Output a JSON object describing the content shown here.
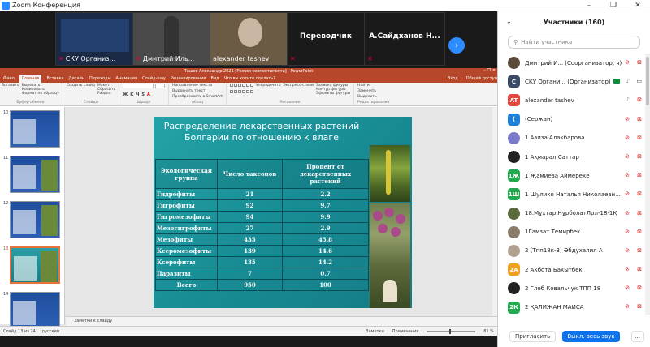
{
  "window": {
    "title": "Zoom Конференция",
    "minimize": "–",
    "restore": "❐",
    "close": "✕",
    "accent": "#2D8CFF"
  },
  "strip": {
    "tiles": [
      {
        "name": "СКУ Организ...",
        "bg": "#1b2a44"
      },
      {
        "name": "Дмитрий Иль...",
        "bg": "#4a4a4a"
      },
      {
        "name": "alexander tashev",
        "bg": "#6b5a44"
      },
      {
        "name": "Переводчик",
        "bg": "#1a1a1a"
      },
      {
        "name": "А.Сайдханов  Н...",
        "bg": "#1a1a1a"
      }
    ],
    "next_icon": "›"
  },
  "ppt": {
    "window_title": "Ташев Александр 2021 [Режим совместимости] - PowerPoint",
    "tabs": [
      "Файл",
      "Главная",
      "Вставка",
      "Дизайн",
      "Переходы",
      "Анимация",
      "Слайд-шоу",
      "Рецензирование",
      "Вид",
      "Что вы хотите сделать?"
    ],
    "active_tab": "Главная",
    "signin": "Вход",
    "share_label": "Общий доступ",
    "ribbon": {
      "paste": "Вставить",
      "cut": "Вырезать",
      "copy": "Копировать",
      "format_painter": "Формат по образцу",
      "clipboard": "Буфер обмена",
      "new_slide": "Создать слайд",
      "layout": "Макет",
      "reset": "Сбросить",
      "section": "Раздел",
      "slides": "Слайды",
      "font": "Шрифт",
      "text_direction": "Направление текста",
      "align_text": "Выровнять текст",
      "smartart": "Преобразовать в SmartArt",
      "paragraph": "Абзац",
      "drawing": "Рисование",
      "arrange": "Упорядочить",
      "quick_styles": "Экспресс-стили",
      "fill": "Заливка фигуры",
      "outline": "Контур фигуры",
      "effects": "Эффекты фигуры",
      "find": "Найти",
      "replace": "Заменить",
      "select": "Выделить",
      "editing": "Редактирование"
    },
    "thumbs": [
      {
        "no": "10",
        "sel": false
      },
      {
        "no": "11",
        "sel": false
      },
      {
        "no": "12",
        "sel": false
      },
      {
        "no": "13",
        "sel": true
      },
      {
        "no": "14",
        "sel": false
      }
    ],
    "slide": {
      "title": "Распределение лекарственных растений Болгарии по отношению к влаге",
      "headers": [
        "Экологическая группа",
        "Число таксонов",
        "Процент от лекарственных растений"
      ],
      "rows": [
        [
          "Гидрофиты",
          "21",
          "2.2"
        ],
        [
          "Гигрофиты",
          "92",
          "9.7"
        ],
        [
          "Гигромезофиты",
          "94",
          "9.9"
        ],
        [
          "Мезогигрофиты",
          "27",
          "2.9"
        ],
        [
          "Мезофиты",
          "435",
          "45.8"
        ],
        [
          "Ксеромезофиты",
          "139",
          "14.6"
        ],
        [
          "Ксерофиты",
          "135",
          "14.2"
        ],
        [
          "Паразиты",
          "7",
          "0.7"
        ],
        [
          "Всего",
          "950",
          "100"
        ]
      ]
    },
    "notes": "Заметки к слайду",
    "status": {
      "slide_of": "Слайд 13 из 24",
      "language": "русский",
      "notes_btn": "Заметки",
      "comments_btn": "Примечания",
      "zoom": "81 %"
    }
  },
  "participants": {
    "title": "Участники (160)",
    "search_placeholder": "Найти участника",
    "list": [
      {
        "name": "Дмитрий И... (Соорганизатор, я)",
        "avatar": "",
        "color": "#5a4a3a",
        "photo": true,
        "mic": "off",
        "video": "off"
      },
      {
        "name": "СКУ Органи... (Организатор)",
        "avatar": "С",
        "color": "#3a4a66",
        "photo": false,
        "mic": "on",
        "video": "on",
        "badge": true
      },
      {
        "name": "alexander tashev",
        "avatar": "AT",
        "color": "#e0483e",
        "photo": false,
        "mic": "on",
        "video": "off"
      },
      {
        "name": "(Сержан)",
        "avatar": "(",
        "color": "#1e7fd8",
        "photo": false,
        "mic": "off",
        "video": "off"
      },
      {
        "name": "1 Азиза Алакбарова",
        "avatar": "",
        "color": "#7a7ac8",
        "photo": true,
        "mic": "off",
        "video": "off"
      },
      {
        "name": "1 Ақмарал Саттар",
        "avatar": "",
        "color": "#222222",
        "photo": true,
        "mic": "off",
        "video": "off"
      },
      {
        "name": "1 Жамиева Аймереке",
        "avatar": "1Ж",
        "color": "#23a850",
        "photo": false,
        "mic": "off",
        "video": "off"
      },
      {
        "name": "1 Шулико Наталья Николаевн...",
        "avatar": "1Ш",
        "color": "#23a850",
        "photo": false,
        "mic": "off",
        "video": "off"
      },
      {
        "name": "18.Мұхтар НұрболатЛрл-18-1Қ",
        "avatar": "",
        "color": "#5a6a3a",
        "photo": true,
        "mic": "off",
        "video": "off"
      },
      {
        "name": "1Гамзат Темирбек",
        "avatar": "",
        "color": "#8a7a6a",
        "photo": true,
        "mic": "off",
        "video": "off"
      },
      {
        "name": "2 (Тпп18к-3) Әбдухалил А",
        "avatar": "",
        "color": "#b0a090",
        "photo": true,
        "mic": "off",
        "video": "off"
      },
      {
        "name": "2 Акбота Бакытбек",
        "avatar": "2А",
        "color": "#f0a020",
        "photo": false,
        "mic": "off",
        "video": "off"
      },
      {
        "name": "2 Глеб Ковальчук ТПП 18",
        "avatar": "",
        "color": "#222222",
        "photo": true,
        "mic": "off",
        "video": "off"
      },
      {
        "name": "2 ҚАЛИЖАН МАЙСА",
        "avatar": "2К",
        "color": "#23a850",
        "photo": false,
        "mic": "off",
        "video": "off"
      }
    ],
    "invite": "Пригласить",
    "mute_all": "Выкл. весь звук",
    "more": "..."
  }
}
